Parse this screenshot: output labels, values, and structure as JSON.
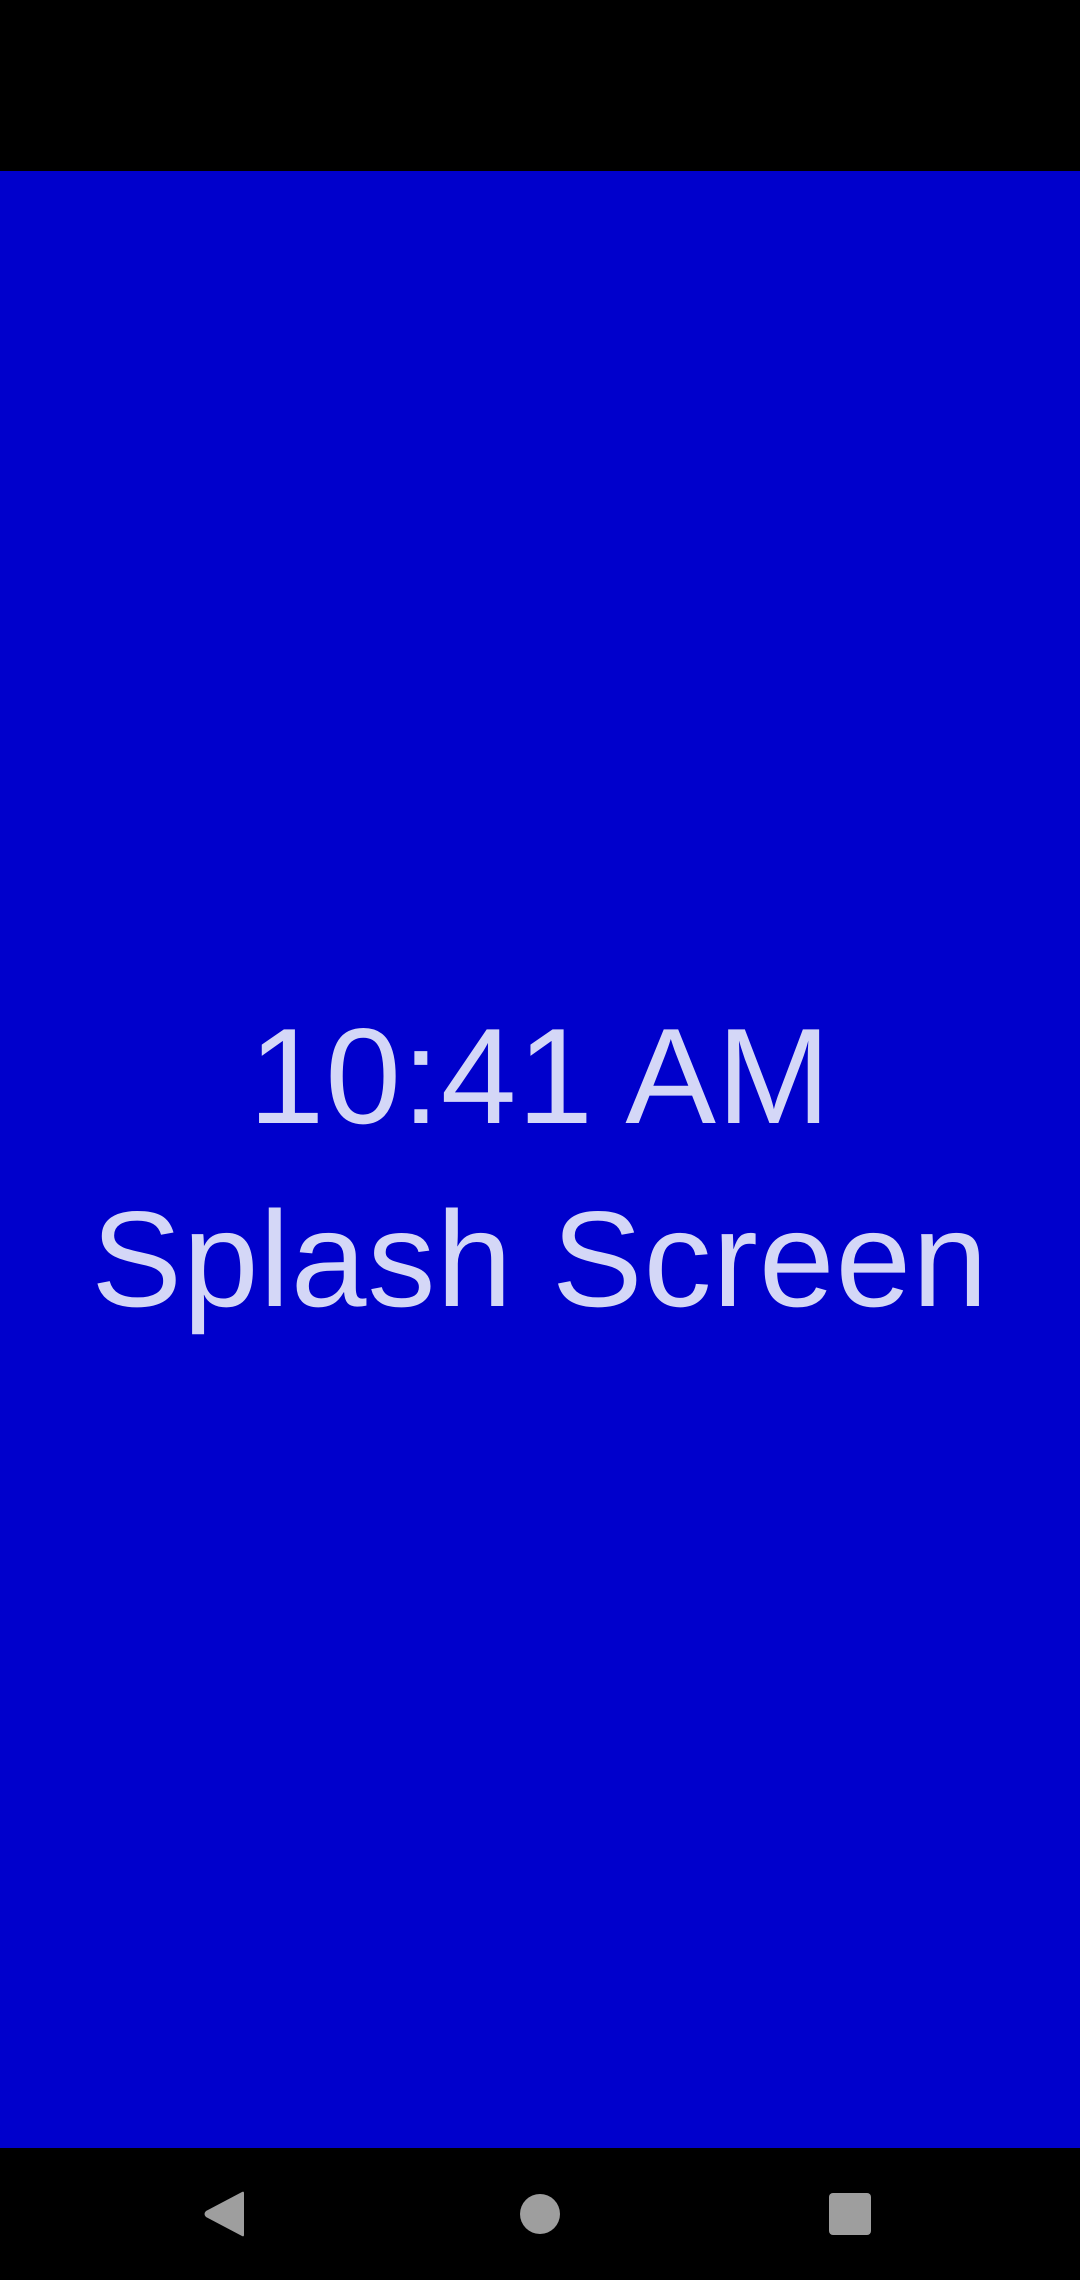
{
  "splash": {
    "time": "10:41 AM",
    "title": "Splash Screen",
    "background_color": "#0000CC",
    "text_color": "#D4D7F7"
  },
  "navigation_bar": {
    "buttons": [
      {
        "icon": "back-triangle-icon"
      },
      {
        "icon": "home-circle-icon"
      },
      {
        "icon": "recents-square-icon"
      }
    ],
    "icon_color": "#9E9E9E"
  }
}
